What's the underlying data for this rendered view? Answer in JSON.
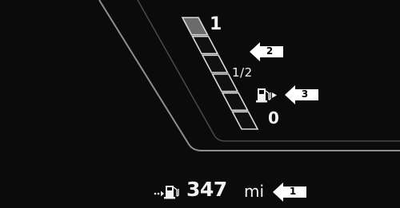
{
  "gauge": {
    "label_full": "1",
    "label_half": "1/2",
    "label_empty": "0",
    "segments_total": 6,
    "segments_filled": 1,
    "fill_color": "#6b6b6b",
    "empty_color": "#d9d9d9"
  },
  "range": {
    "value": "347",
    "unit": "mi",
    "icon": "range-fuel-pump-icon"
  },
  "icons": {
    "fuel": "fuel-pump-icon"
  },
  "callouts": [
    {
      "number": "1"
    },
    {
      "number": "2"
    },
    {
      "number": "3"
    }
  ],
  "colors": {
    "background": "#0b0b0b",
    "frame_line": "#9a9a9a",
    "text": "#f2f2f2",
    "callout": "#ffffff"
  }
}
